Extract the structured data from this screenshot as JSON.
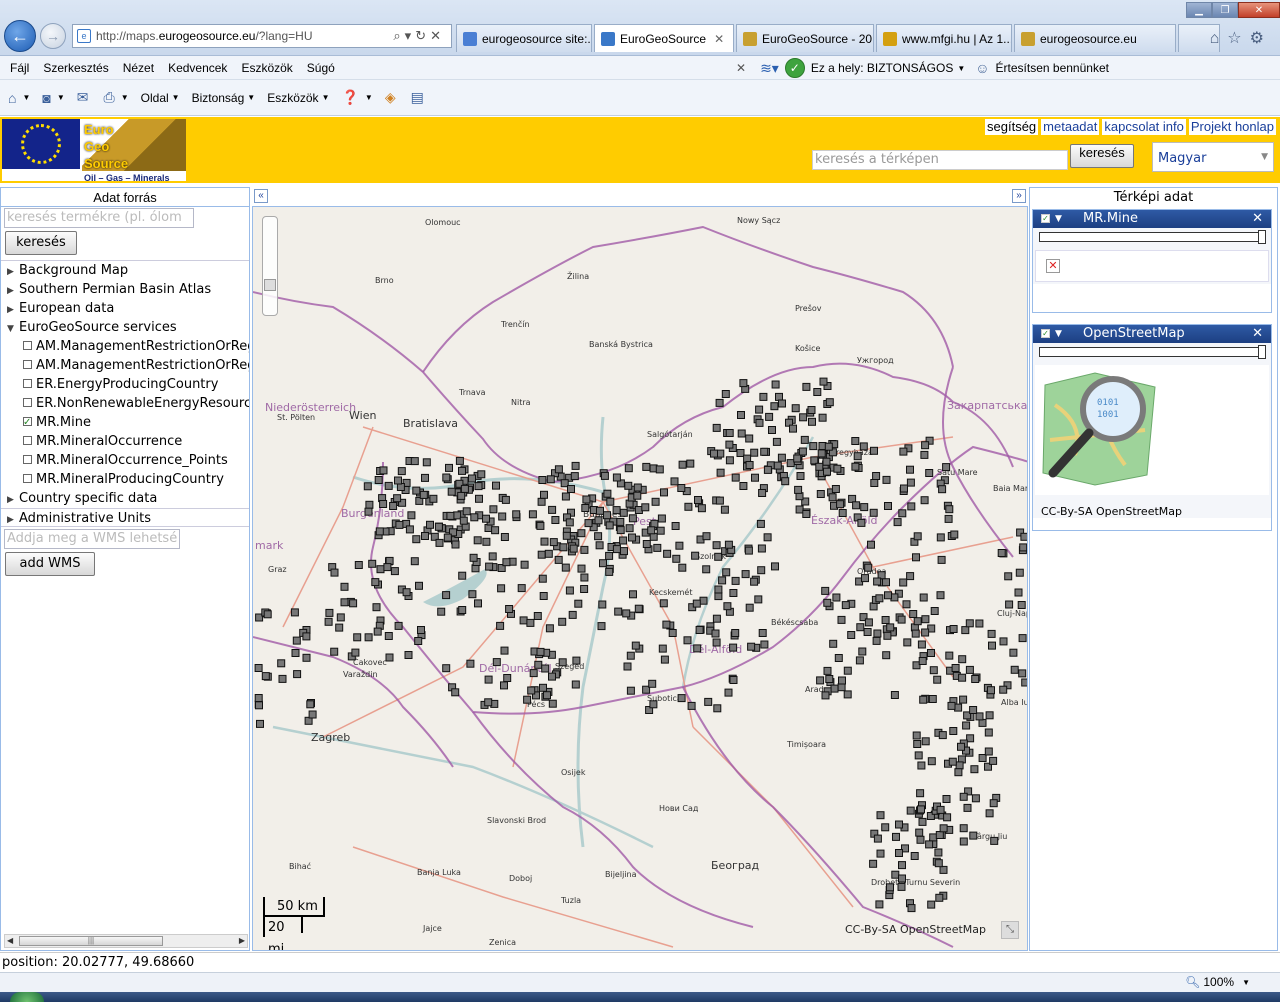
{
  "browser": {
    "address": {
      "prefix": "http://maps.",
      "domain": "eurogeosource.eu",
      "path": "/?lang=HU"
    },
    "tabs": [
      {
        "label": "eurogeosource site:...",
        "active": false,
        "color": "#4a7fd4"
      },
      {
        "label": "EuroGeoSource",
        "active": true,
        "color": "#3a78c8",
        "close": "✕"
      },
      {
        "label": "EuroGeoSource - 20...",
        "active": false,
        "color": "#c8a030"
      },
      {
        "label": "www.mfgi.hu | Az 1...",
        "active": false,
        "color": "#d4a010"
      },
      {
        "label": "eurogeosource.eu",
        "active": false,
        "color": "#c8a030"
      }
    ],
    "menu": [
      "Fájl",
      "Szerkesztés",
      "Nézet",
      "Kedvencek",
      "Eszközök",
      "Súgó"
    ],
    "security_label": "Ez a hely: BIZTONSÁGOS",
    "notify_label": "Értesítsen bennünket",
    "toolbar": {
      "page": "Oldal",
      "security": "Biztonság",
      "tools": "Eszközök"
    },
    "zoom": "100%"
  },
  "header": {
    "logo": {
      "euro": "Euro",
      "geo": "Geo",
      "source": "Source",
      "tagline": "Oil – Gas – Minerals"
    },
    "links": [
      "segítség",
      "metaadat",
      "kapcsolat info",
      "Projekt honlap"
    ],
    "search_placeholder": "keresés a térképen",
    "search_button": "keresés",
    "language": "Magyar"
  },
  "left_panel": {
    "title": "Adat forrás",
    "search_placeholder": "keresés termékre (pl. ólom v",
    "search_button": "keresés",
    "tree": [
      {
        "label": "Background Map",
        "expanded": false
      },
      {
        "label": "Southern Permian Basin Atlas",
        "expanded": false
      },
      {
        "label": "European data",
        "expanded": false
      },
      {
        "label": "EuroGeoSource services",
        "expanded": true
      }
    ],
    "services": [
      {
        "label": "AM.ManagementRestrictionOrRegulationZone",
        "checked": false
      },
      {
        "label": "AM.ManagementRestrictionOrRegulationZone",
        "checked": false
      },
      {
        "label": "ER.EnergyProducingCountry",
        "checked": false
      },
      {
        "label": "ER.NonRenewableEnergyResource",
        "checked": false
      },
      {
        "label": "MR.Mine",
        "checked": true
      },
      {
        "label": "MR.MineralOccurrence",
        "checked": false
      },
      {
        "label": "MR.MineralOccurrence_Points",
        "checked": false
      },
      {
        "label": "MR.MineralProducingCountry",
        "checked": false
      }
    ],
    "country_specific": "Country specific data",
    "admin_units": "Administrative Units",
    "wms_placeholder": "Addja meg a WMS lehetsé",
    "add_wms": "add WMS"
  },
  "map": {
    "labels": [
      {
        "t": "Olomouc",
        "s": 8
      },
      {
        "t": "Nowy Sącz",
        "s": 8
      },
      {
        "t": "Brno",
        "s": 8
      },
      {
        "t": "Žilina",
        "s": 8
      },
      {
        "t": "Prešov",
        "s": 8
      },
      {
        "t": "Trenčín",
        "s": 8
      },
      {
        "t": "Banská Bystrica",
        "s": 8
      },
      {
        "t": "Košice",
        "s": 8
      },
      {
        "t": "Ужгород",
        "s": 8
      },
      {
        "t": "Trnava",
        "s": 8
      },
      {
        "t": "Nitra",
        "s": 8
      },
      {
        "t": "Niederösterreich",
        "s": 11,
        "c": "#a06aa6"
      },
      {
        "t": "Wien",
        "s": 11
      },
      {
        "t": "St. Pölten",
        "s": 8
      },
      {
        "t": "Bratislava",
        "s": 11
      },
      {
        "t": "Закарпатська о",
        "s": 11,
        "c": "#a06aa6"
      },
      {
        "t": "Salgótarján",
        "s": 8
      },
      {
        "t": "Nyíregyháza",
        "s": 8
      },
      {
        "t": "Satu Mare",
        "s": 8
      },
      {
        "t": "Baia Mare",
        "s": 8
      },
      {
        "t": "Burgenland",
        "s": 11,
        "c": "#a06aa6"
      },
      {
        "t": "Budapest",
        "s": 9
      },
      {
        "t": "Pest",
        "s": 11,
        "c": "#a06aa6"
      },
      {
        "t": "Észak-Alföld",
        "s": 11,
        "c": "#a06aa6"
      },
      {
        "t": "Graz",
        "s": 8
      },
      {
        "t": "Szolnok",
        "s": 8
      },
      {
        "t": "Oradea",
        "s": 8
      },
      {
        "t": "Kecskemét",
        "s": 8
      },
      {
        "t": "Cluj-Napoca",
        "s": 8
      },
      {
        "t": "Békéscsaba",
        "s": 8
      },
      {
        "t": "Dél-Alföld",
        "s": 11,
        "c": "#a06aa6"
      },
      {
        "t": "Čakovec",
        "s": 8
      },
      {
        "t": "Varaždin",
        "s": 8
      },
      {
        "t": "Dél-Dunántúl",
        "s": 11,
        "c": "#a06aa6"
      },
      {
        "t": "Szeged",
        "s": 8
      },
      {
        "t": "Arad",
        "s": 8
      },
      {
        "t": "Pécs",
        "s": 8
      },
      {
        "t": "Subotica",
        "s": 8
      },
      {
        "t": "Alba Iulia",
        "s": 8
      },
      {
        "t": "Zagreb",
        "s": 11
      },
      {
        "t": "Timișoara",
        "s": 8
      },
      {
        "t": "Osijek",
        "s": 8
      },
      {
        "t": "Нови Сад",
        "s": 8
      },
      {
        "t": "Slavonski Brod",
        "s": 8
      },
      {
        "t": "Târgu Jiu",
        "s": 8
      },
      {
        "t": "Bihać",
        "s": 8
      },
      {
        "t": "Banja Luka",
        "s": 8
      },
      {
        "t": "Doboj",
        "s": 8
      },
      {
        "t": "Bijeljina",
        "s": 8
      },
      {
        "t": "Београд",
        "s": 11
      },
      {
        "t": "Drobeta-Turnu Severin",
        "s": 8
      },
      {
        "t": "Tuzla",
        "s": 8
      },
      {
        "t": "Jajce",
        "s": 8
      },
      {
        "t": "Zenica",
        "s": 8
      },
      {
        "t": "mark",
        "s": 11,
        "c": "#a06aa6"
      }
    ],
    "scale_km": "50 km",
    "scale_mi": "20 mi",
    "attribution": "CC-By-SA OpenStreetMap",
    "mine_marker_color": "#777777"
  },
  "right_panel": {
    "title": "Térképi adat",
    "layers": [
      {
        "name": "MR.Mine"
      },
      {
        "name": "OpenStreetMap",
        "attribution": "CC-By-SA OpenStreetMap"
      }
    ]
  },
  "status": {
    "position": "position: 20.02777, 49.68660"
  }
}
